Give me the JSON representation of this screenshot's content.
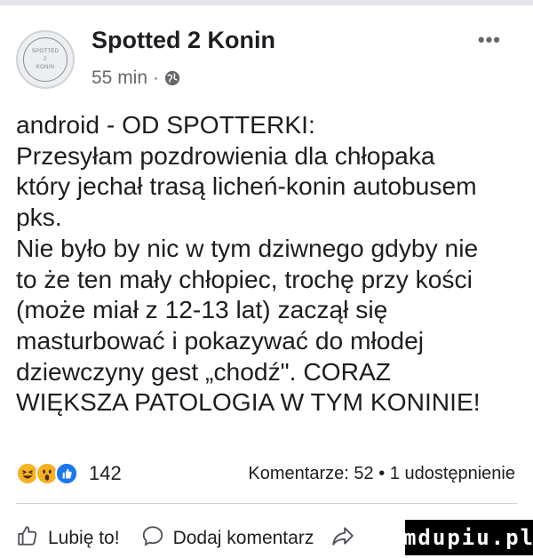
{
  "post": {
    "page_name": "Spotted 2 Konin",
    "avatar_lines": [
      "SPOTTED",
      "2",
      "KONIN"
    ],
    "time": "55 min",
    "separator": "·",
    "audience_icon": "globe-icon",
    "more_icon": "•••",
    "text_lines": [
      "android - OD SPOTTERKI:",
      "Przesyłam pozdrowienia dla chłopaka",
      "który jechał trasą licheń-konin autobusem",
      "pks.",
      "Nie było by nic w tym dziwnego gdyby nie",
      "to że ten mały chłopiec, trochę przy kości",
      "(może miał z 12-13 lat) zaczął się",
      "masturbować i pokazywać do młodej",
      "dziewczyny gest „chodź\". CORAZ",
      "WIĘKSZA PATOLOGIA W TYM KONINIE!"
    ]
  },
  "reactions": {
    "icons": [
      "haha-icon",
      "wow-icon",
      "like-icon"
    ],
    "count": "142",
    "comments": "Komentarze: 52",
    "dot": "•",
    "shares": "1 udostępnienie"
  },
  "actions": {
    "like_label": "Lubię to!",
    "comment_label": "Dodaj komentarz",
    "share_icon": "share-icon"
  },
  "watermark": "mdupiu.pl",
  "colors": {
    "like_blue": "#1877f2",
    "emoji_yellow": "#f7b125",
    "secondary_text": "#65676b"
  }
}
